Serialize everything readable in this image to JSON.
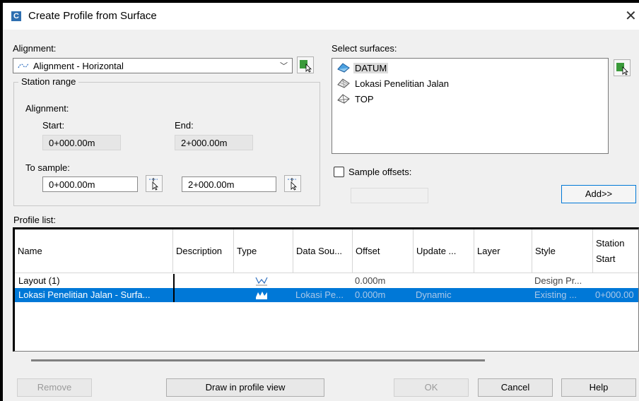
{
  "window": {
    "title": "Create Profile from Surface",
    "close_icon": "close-icon"
  },
  "alignment": {
    "label": "Alignment:",
    "selected": "Alignment - Horizontal"
  },
  "station_range": {
    "label": "Station range",
    "alignment_label": "Alignment:",
    "start_label": "Start:",
    "end_label": "End:",
    "start_value": "0+000.00m",
    "end_value": "2+000.00m",
    "to_sample_label": "To sample:",
    "sample_start": "0+000.00m",
    "sample_end": "2+000.00m"
  },
  "surfaces": {
    "label": "Select surfaces:",
    "items": [
      {
        "label": "DATUM",
        "selected": true
      },
      {
        "label": "Lokasi Penelitian Jalan",
        "selected": false
      },
      {
        "label": "TOP",
        "selected": false
      }
    ]
  },
  "sample_offsets": {
    "label": "Sample offsets:",
    "checked": false
  },
  "add_button": "Add>>",
  "profile_list": {
    "label": "Profile list:",
    "columns": [
      "Name",
      "Description",
      "Type",
      "Data Sou...",
      "Offset",
      "Update ...",
      "Layer",
      "Style",
      "Station Start"
    ],
    "rows": [
      {
        "name": "Layout (1)",
        "description": "",
        "type": "layout-profile-icon",
        "data_source": "",
        "offset": "0.000m",
        "update": "",
        "layer": "",
        "style": "Design Pr...",
        "station_start": "",
        "selected": false
      },
      {
        "name": "Lokasi Penelitian Jalan - Surfa...",
        "description": "",
        "type": "surface-profile-icon",
        "data_source": "Lokasi Pe...",
        "offset": "0.000m",
        "update": "Dynamic",
        "layer": "",
        "style": "Existing ...",
        "station_start": "0+000.00",
        "selected": true
      }
    ]
  },
  "buttons": {
    "remove": "Remove",
    "draw": "Draw in profile view",
    "ok": "OK",
    "cancel": "Cancel",
    "help": "Help"
  },
  "colors": {
    "selection": "#0078d7",
    "accent_icon": "#2f6fb0",
    "pick_icon": "#3a9a3a"
  }
}
